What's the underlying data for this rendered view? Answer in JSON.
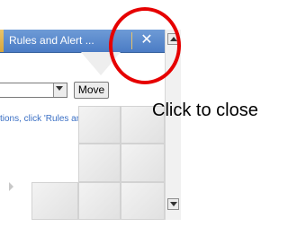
{
  "tab": {
    "title": "Rules and Alert ...",
    "close_glyph": "✕",
    "close_icon": "close-icon",
    "accent_color": "#4b7cc5"
  },
  "toolbar": {
    "move_label": "Move"
  },
  "hint": {
    "text": "tions, click 'Rules an"
  },
  "annotation": {
    "label": "Click to close",
    "circle_color": "#e60000"
  }
}
